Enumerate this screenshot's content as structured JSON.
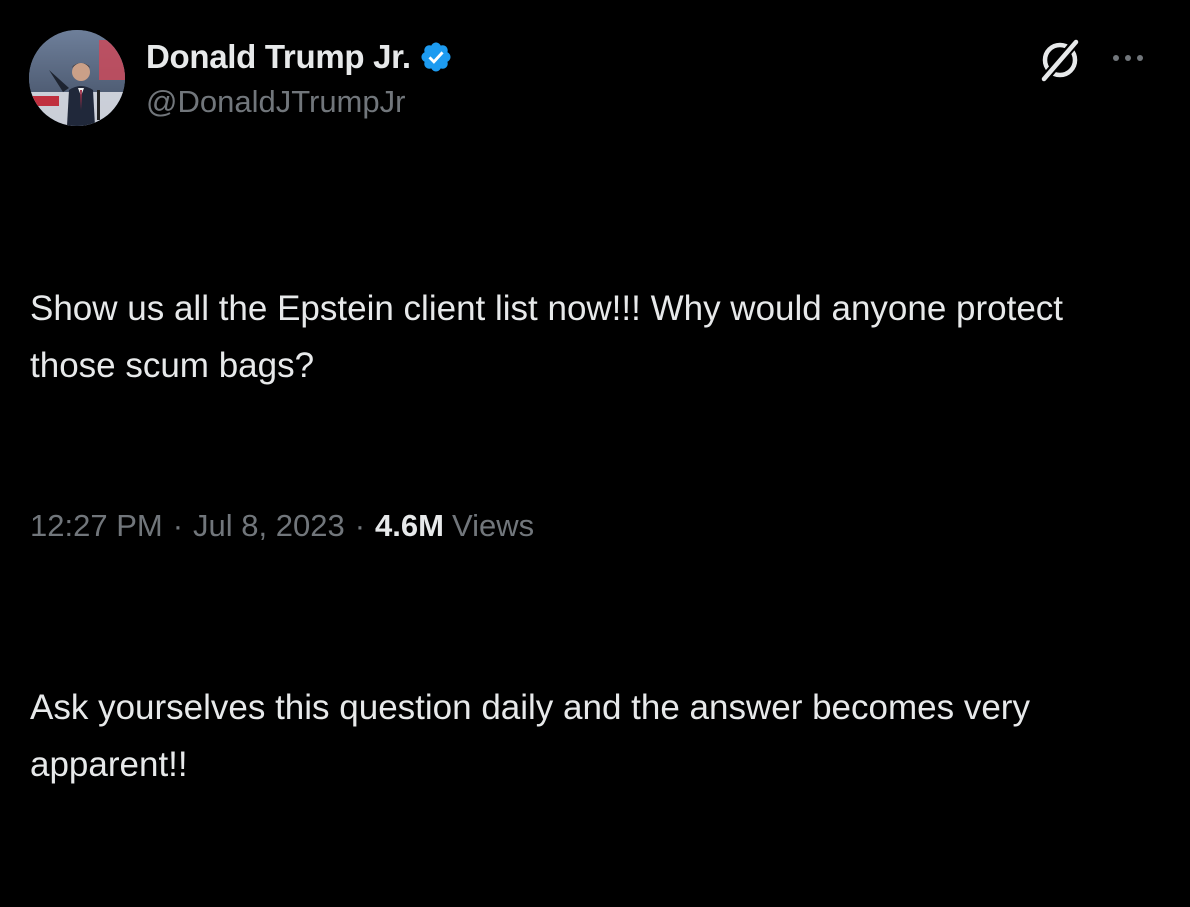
{
  "author": {
    "display_name": "Donald Trump Jr.",
    "handle": "@DonaldJTrumpJr",
    "verified": true,
    "avatar_icon": "profile-photo"
  },
  "actions": {
    "grok_icon": "grok-icon",
    "more_icon": "more-icon"
  },
  "tweet": {
    "paragraphs": [
      "Show us all the Epstein client list now!!! Why would anyone protect those scum bags?",
      "Ask yourselves this question daily and the answer becomes very apparent!!"
    ]
  },
  "meta": {
    "time": "12:27 PM",
    "separator": "·",
    "date": "Jul 8, 2023",
    "views_count": "4.6M",
    "views_label": "Views"
  },
  "colors": {
    "background": "#000000",
    "primary_text": "#e7e9ea",
    "secondary_text": "#71767b",
    "verified_blue": "#1d9bf0"
  }
}
